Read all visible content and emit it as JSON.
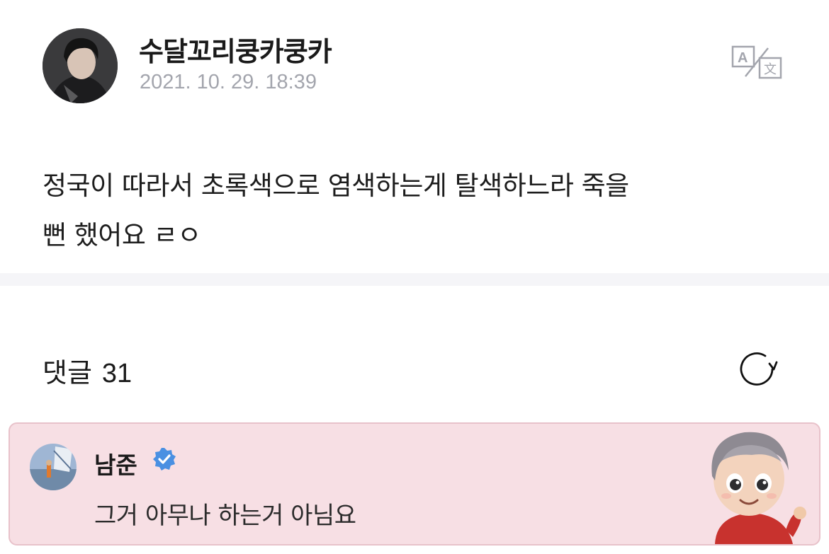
{
  "post": {
    "author": "수달꼬리쿵카쿵카",
    "date": "2021. 10. 29. 18:39",
    "body_line1": "정국이 따라서 초록색으로 염색하는게 탈색하느라 죽을",
    "body_line2": "뻔 했어요 ㄹㅇ"
  },
  "comments": {
    "label": "댓글",
    "count": "31"
  },
  "comment": {
    "author": "남준",
    "text": "그거 아무나 하는거 아님요"
  },
  "icons": {
    "translate": "translate-icon",
    "refresh": "refresh-icon",
    "verified": "verified-badge-icon"
  },
  "colors": {
    "comment_bg": "#f7dfe4",
    "comment_border": "#e8c2ca",
    "verified": "#4a90e2",
    "date": "#a3a5ad",
    "divider": "#f5f5f8"
  }
}
